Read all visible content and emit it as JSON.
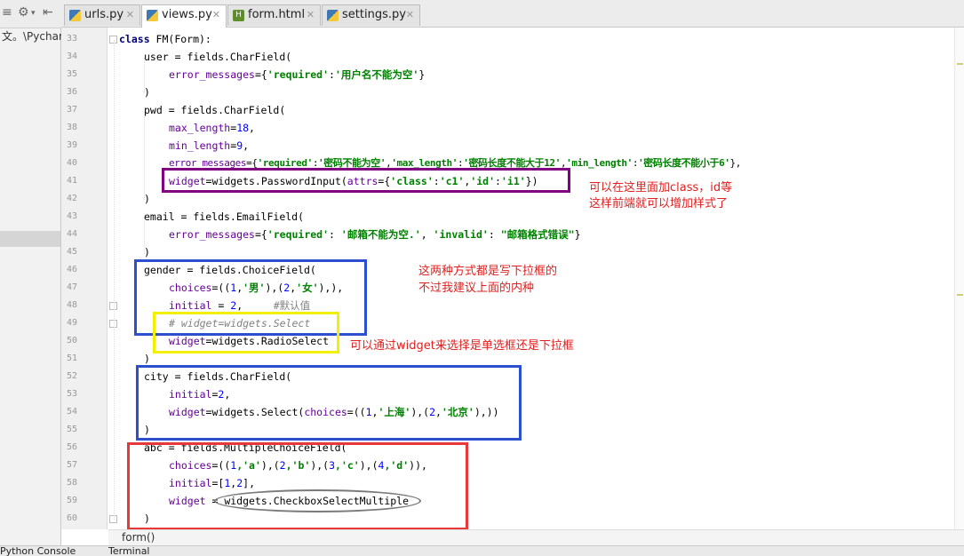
{
  "sidebar": {
    "path_text": "文。\\Pycharm"
  },
  "tabs": [
    {
      "label": "urls.py",
      "active": false
    },
    {
      "label": "views.py",
      "active": true
    },
    {
      "label": "form.html",
      "active": false
    },
    {
      "label": "settings.py",
      "active": false
    }
  ],
  "editor": {
    "line_numbers": [
      "33",
      "34",
      "35",
      "36",
      "37",
      "38",
      "39",
      "40",
      "41",
      "42",
      "43",
      "44",
      "45",
      "46",
      "47",
      "48",
      "49",
      "50",
      "51",
      "52",
      "53",
      "54",
      "55",
      "56",
      "57",
      "58",
      "59",
      "60"
    ],
    "breadcrumb": "form()"
  },
  "annotations": {
    "purple_note_line1": "可以在这里面加class，id等",
    "purple_note_line2": "这样前端就可以增加样式了",
    "blue_note_line1": "这两种方式都是写下拉框的",
    "blue_note_line2": "不过我建议上面的内种",
    "yellow_note": "可以通过widget来选择是单选框还是下拉框",
    "colors": {
      "purple": "#800080",
      "blue": "#2b4fcf",
      "yellow": "#f2f000",
      "red": "#e8393a",
      "gray": "#7a7a7a",
      "note_red": "#e02020"
    }
  },
  "bottom_bar": {
    "python_console": "Python Console",
    "terminal": "Terminal"
  },
  "code": {
    "l33": {
      "kw": "class",
      "rest": " FM(Form):"
    },
    "l34": "user = fields.CharField(",
    "l35": {
      "arg": "error_messages",
      "eq": "={",
      "s1": "'required'",
      "c": ":",
      "s2": "'用户名不能为空'",
      "end": "}"
    },
    "l36": ")",
    "l37": "pwd = fields.CharField(",
    "l38": {
      "arg": "max_length",
      "eq": "=",
      "num": "18",
      "end": ","
    },
    "l39": {
      "arg": "min_length",
      "eq": "=",
      "num": "9",
      "end": ","
    },
    "l40": {
      "arg": "error_messages",
      "eq": "={",
      "s1": "'required'",
      "c1": ":",
      "s2": "'密码不能为空'",
      "c2": ",",
      "s3": "'max_length'",
      "c3": ":",
      "s4": "'密码长度不能大于12'",
      "c4": ",",
      "s5": "'min_length'",
      "c5": ":",
      "s6": "'密码长度不能小于6'",
      "end": "},"
    },
    "l41": {
      "arg": "widget",
      "mid": "=widgets.PasswordInput(",
      "arg2": "attrs",
      "eq": "={",
      "s1": "'class'",
      "c1": ":",
      "s2": "'c1'",
      "c2": ",",
      "s3": "'id'",
      "c3": ":",
      "s4": "'i1'",
      "end": "})"
    },
    "l42": ")",
    "l43": "email = fields.EmailField(",
    "l44": {
      "arg": "error_messages",
      "eq": "={",
      "s1": "'required'",
      "c1": ": ",
      "s2": "'邮箱不能为空.'",
      "c2": ", ",
      "s3": "'invalid'",
      "c3": ": ",
      "s4": "\"邮箱格式错误\"",
      "end": "}"
    },
    "l45": ")",
    "l46": "gender = fields.ChoiceField(",
    "l47": {
      "arg": "choices",
      "a": "=((",
      "n1": "1",
      "b": ",",
      "s1": "'男'",
      "c": "),(",
      "n2": "2",
      "d": ",",
      "s2": "'女'",
      "end": "),),"
    },
    "l48": {
      "arg": "initial",
      "eq": " = ",
      "num": "2",
      "end": ",     ",
      "cm": "#默认值"
    },
    "l49": "# widget=widgets.Select",
    "l50": {
      "arg": "widget",
      "rest": "=widgets.RadioSelect"
    },
    "l51": ")",
    "l52": "city = fields.CharField(",
    "l53": {
      "arg": "initial",
      "eq": "=",
      "num": "2",
      "end": ","
    },
    "l54": {
      "arg": "widget",
      "mid": "=widgets.Select(",
      "arg2": "choices",
      "a": "=((",
      "n1": "1",
      "b": ",",
      "s1": "'上海'",
      "c": "),(",
      "n2": "2",
      "d": ",",
      "s2": "'北京'",
      "end": "),))"
    },
    "l55": ")",
    "l56": "abc = fields.MultipleChoiceField(",
    "l57": {
      "arg": "choices",
      "a": "=((",
      "n1": "1",
      "s1": ",'a'",
      "b": "),(",
      "n2": "2",
      "s2": ",'b'",
      "c": "),(",
      "n3": "3",
      "s3": ",'c'",
      "d": "),(",
      "n4": "4",
      "s4": ",'d'",
      "end": ")),"
    },
    "l58": {
      "arg": "initial",
      "a": "=[",
      "n1": "1",
      "b": ",",
      "n2": "2",
      "end": "],"
    },
    "l59": {
      "arg": "widget",
      "rest": " = widgets.CheckboxSelectMultiple"
    },
    "l60": ")"
  }
}
